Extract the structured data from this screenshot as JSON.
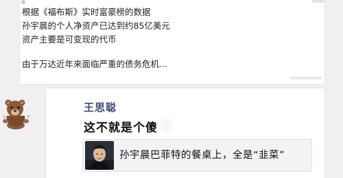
{
  "post": {
    "lines": [
      "根据《福布斯》实时富豪榜的数据",
      "孙宇晨的个人净资产已达到约85亿美元",
      "资产主要是可变现的代币",
      "由于万达近年来面临严重的债务危机..."
    ]
  },
  "comment": {
    "username": "王思聪",
    "text": "这不就是个傻",
    "quote": "孙宇晨巴菲特的餐桌上，全是“韭菜”"
  },
  "icons": {
    "avatar": "cartoon-bear-avatar-icon",
    "quote_thumb": "person-photo-thumbnail"
  }
}
